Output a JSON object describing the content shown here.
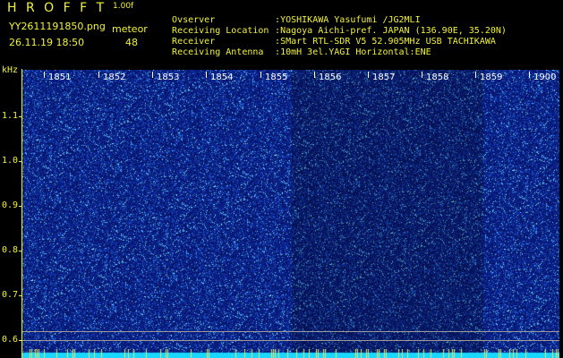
{
  "header": {
    "logo": "H R O F F T",
    "version": "1.00f",
    "file_name": "YY2611191850.png",
    "meteor_label": "meteor",
    "timestamp": "26.11.19 18:50",
    "meteor_count": "48"
  },
  "info": [
    {
      "key": "Ovserver",
      "value": ":YOSHIKAWA Yasufumi /JG2MLI"
    },
    {
      "key": "Receiving Location",
      "value": ":Nagoya Aichi-pref. JAPAN (136.90E, 35.20N)"
    },
    {
      "key": "Receiver",
      "value": ":SMart RTL-SDR V5 52.905MHz USB TACHIKAWA"
    },
    {
      "key": "Receiving Antenna",
      "value": ":10mH 3el.YAGI Horizontal:ENE"
    }
  ],
  "axis": {
    "unit": "kHz",
    "y_ticks": [
      "1.1",
      "1.0",
      "0.9",
      "0.8",
      "0.7",
      "0.6"
    ]
  },
  "time_labels": [
    "1851",
    "1852",
    "1853",
    "1854",
    "1855",
    "1856",
    "1857",
    "1858",
    "1859",
    "1900"
  ],
  "colors": {
    "text": "#f2f23a",
    "background": "#000000",
    "spectrogram_base": "#0a1a6e",
    "noise_cyan": "#3fc8ff",
    "bottom_band": "#19d7ff"
  }
}
